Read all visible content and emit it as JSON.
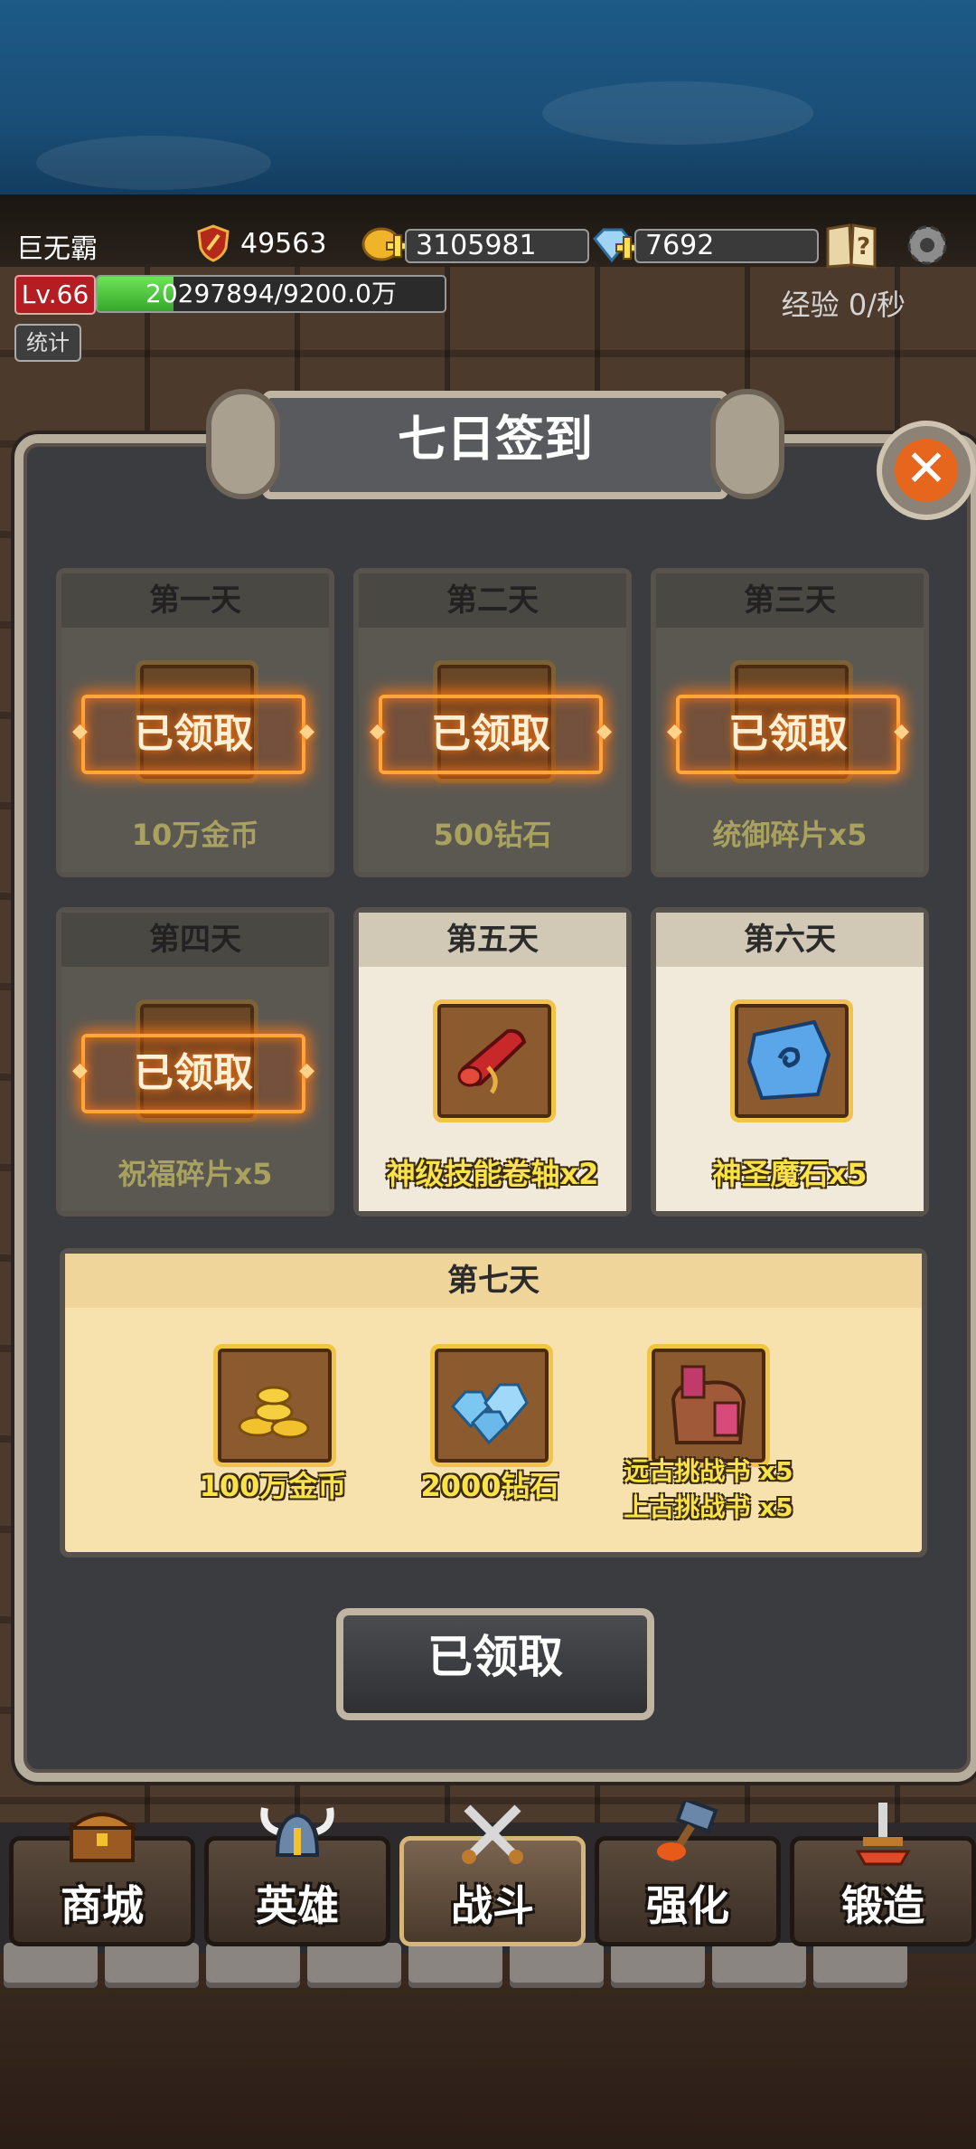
{
  "hud": {
    "player_name": "巨无霸",
    "power": "49563",
    "gold": "3105981",
    "gems": "7692",
    "level": "Lv.66",
    "xp_text": "20297894/9200.0万",
    "xp_progress": 0.22,
    "stats_label": "统计",
    "exp_rate": "经验 0/秒"
  },
  "dialog": {
    "title": "七日签到",
    "claimed_stamp": "已领取",
    "days": [
      {
        "day": "第一天",
        "reward": "10万金币",
        "claimed": true
      },
      {
        "day": "第二天",
        "reward": "500钻石",
        "claimed": true
      },
      {
        "day": "第三天",
        "reward": "统御碎片x5",
        "claimed": true
      },
      {
        "day": "第四天",
        "reward": "祝福碎片x5",
        "claimed": true
      },
      {
        "day": "第五天",
        "reward": "神级技能卷轴x2",
        "claimed": false
      },
      {
        "day": "第六天",
        "reward": "神圣魔石x5",
        "claimed": false
      }
    ],
    "day7": {
      "day": "第七天",
      "rewards": [
        "100万金币",
        "2000钻石",
        "远古挑战书 x5",
        "上古挑战书 x5"
      ]
    },
    "button_label": "已领取"
  },
  "nav": {
    "items": [
      "商城",
      "英雄",
      "战斗",
      "强化",
      "锻造"
    ],
    "active": "战斗"
  },
  "colors": {
    "panel_border": "#b7ad9c",
    "stamp_glow": "#ffa63a",
    "reward_text": "#f9e24a",
    "xp_fill": "#35a82a",
    "close_button": "#e7661e"
  }
}
